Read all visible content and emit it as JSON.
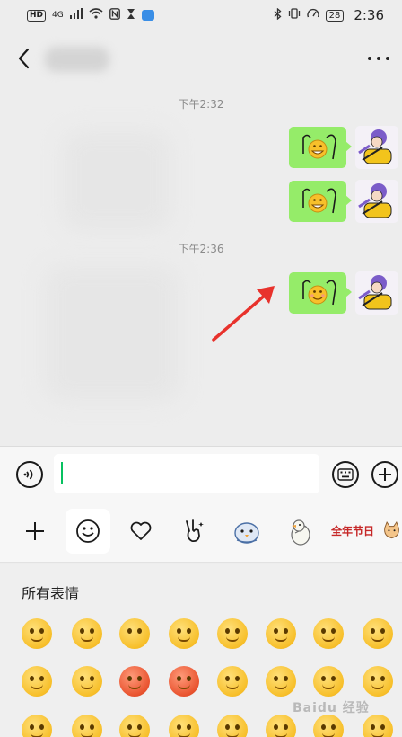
{
  "status_bar": {
    "left_label": "HD",
    "network": "4G",
    "battery": "28",
    "time": "2:36"
  },
  "header": {
    "back_icon": "chevron-left-icon",
    "more_icon": "more-dots-icon"
  },
  "chat": {
    "timestamps": [
      "下午2:32",
      "下午2:36"
    ],
    "bubble_color": "#95ec69"
  },
  "input": {
    "value": ""
  },
  "emoji_tabs": [
    {
      "icon": "plus-icon"
    },
    {
      "icon": "smiley-icon",
      "active": true
    },
    {
      "icon": "heart-icon"
    },
    {
      "icon": "peace-hand-icon"
    },
    {
      "icon": "bird-sticker-icon"
    },
    {
      "icon": "duck-sticker-icon"
    },
    {
      "label": "全年节日"
    },
    {
      "icon": "shiba-sticker-icon"
    }
  ],
  "emoji_panel": {
    "title": "所有表情",
    "watermark": "Baidu 经验"
  },
  "colors": {
    "accent": "#07c160",
    "background": "#ededed",
    "panel": "#efefef"
  }
}
